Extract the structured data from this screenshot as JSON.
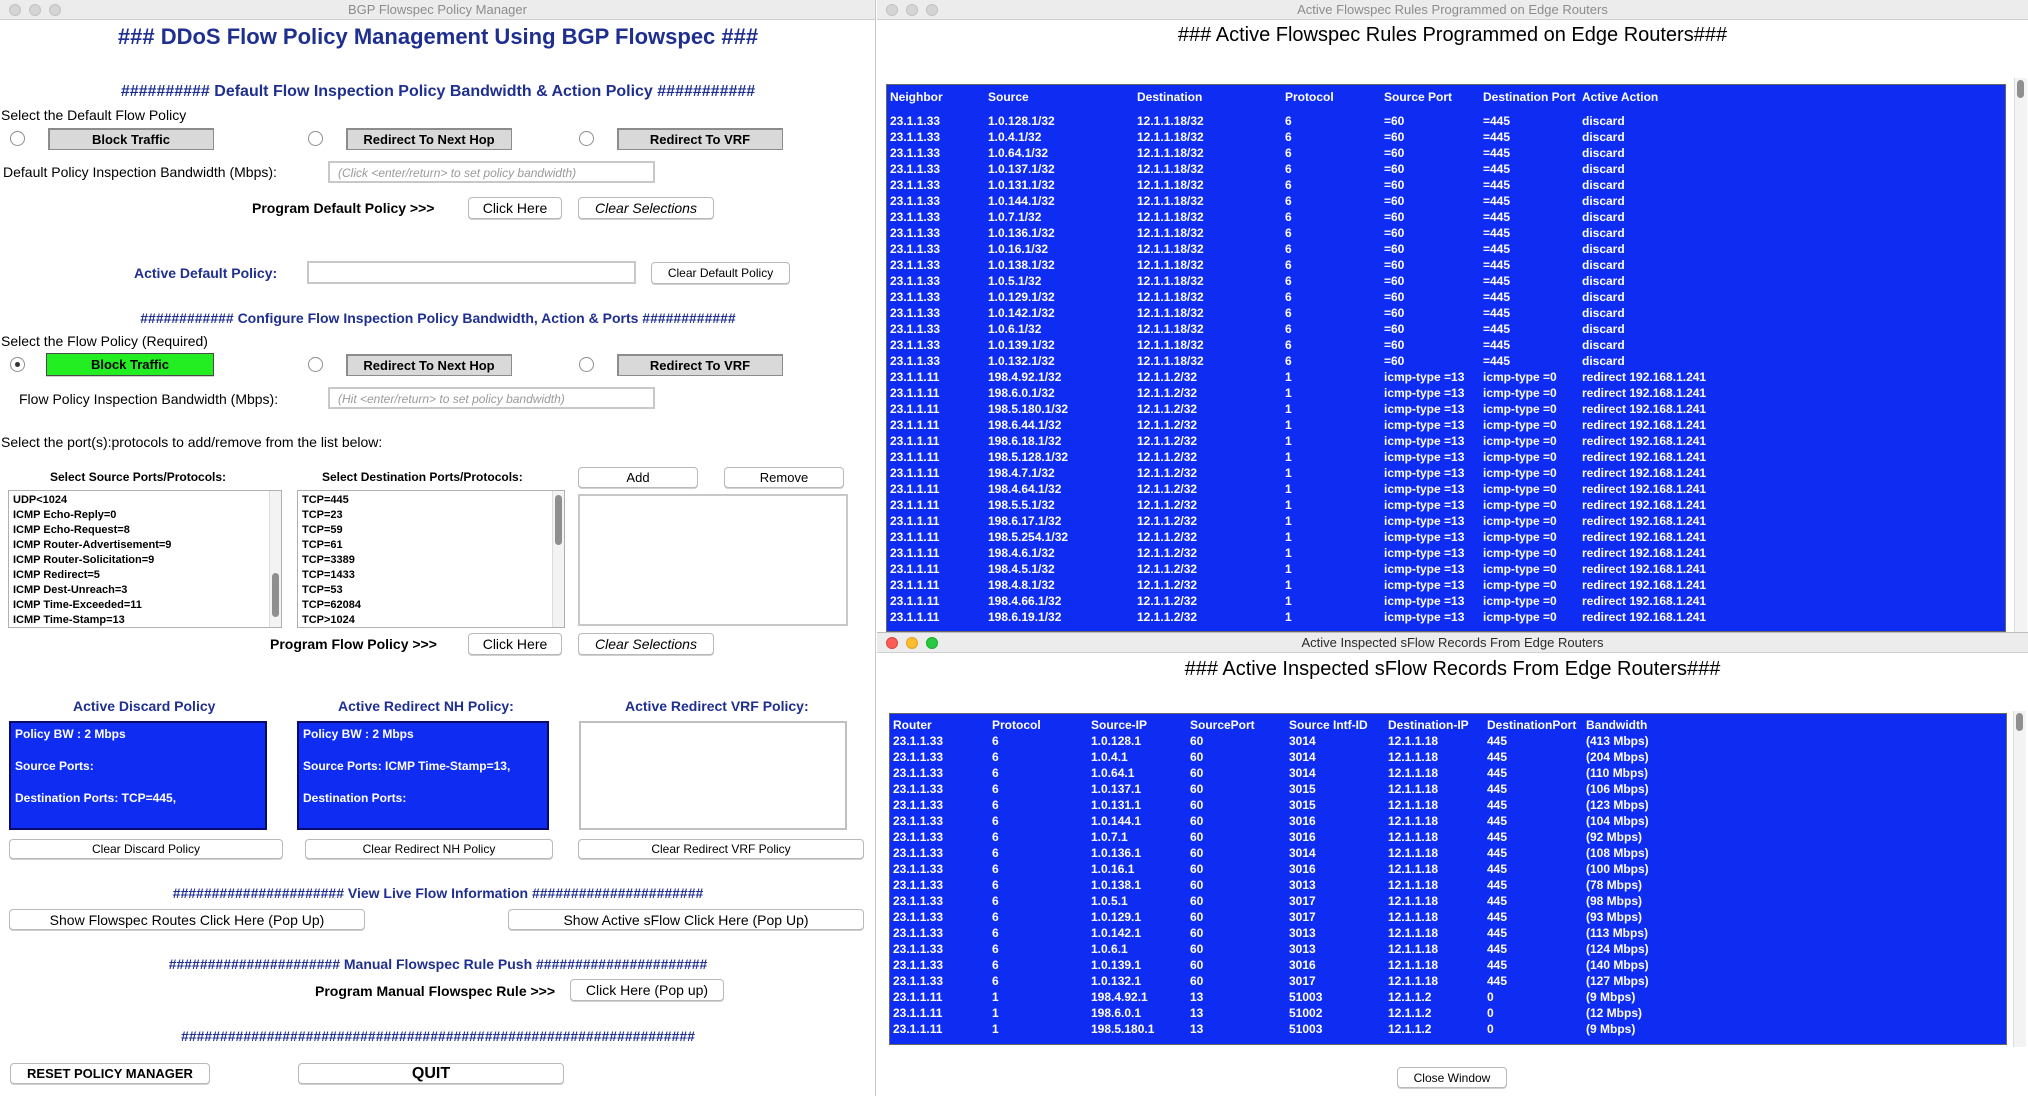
{
  "left": {
    "window_title": "BGP Flowspec Policy Manager",
    "heading": "### DDoS Flow Policy Management Using BGP Flowspec ###",
    "default_section": "########## Default Flow Inspection Policy Bandwidth & Action Policy ###########",
    "select_default_label": "Select the Default Flow Policy",
    "actions": [
      "Block Traffic",
      "Redirect To Next Hop",
      "Redirect To VRF"
    ],
    "default_bw_label": "Default Policy Inspection Bandwidth (Mbps):",
    "default_bw_placeholder": "(Click <enter/return> to set policy bandwidth)",
    "program_default_label": "Program Default Policy >>>",
    "click_here": "Click Here",
    "clear_selections": "Clear Selections",
    "active_default_label": "Active Default Policy:",
    "active_default_value": "",
    "clear_default": "Clear Default Policy",
    "flow_section": "############ Configure Flow Inspection Policy Bandwidth, Action & Ports ############",
    "select_flow_label": "Select the Flow Policy (Required)",
    "flow_bw_label": "Flow Policy Inspection Bandwidth (Mbps):",
    "flow_bw_placeholder": "(Hit <enter/return> to set policy bandwidth)",
    "ports_prompt": "Select the port(s):protocols to add/remove from the list below:",
    "src_ports_label": "Select Source Ports/Protocols:",
    "dst_ports_label": "Select Destination Ports/Protocols:",
    "add": "Add",
    "remove": "Remove",
    "src_ports": [
      "UDP<1024",
      "ICMP Echo-Reply=0",
      "ICMP Echo-Request=8",
      "ICMP Router-Advertisement=9",
      "ICMP Router-Solicitation=9",
      "ICMP Redirect=5",
      "ICMP Dest-Unreach=3",
      "ICMP Time-Exceeded=11",
      "ICMP Time-Stamp=13"
    ],
    "dst_ports": [
      "TCP=445",
      "TCP=23",
      "TCP=59",
      "TCP=61",
      "TCP=3389",
      "TCP=1433",
      "TCP=53",
      "TCP=62084",
      "TCP>1024"
    ],
    "program_flow_label": "Program Flow Policy >>>",
    "discard_title": "Active Discard Policy",
    "redirect_nh_title": "Active Redirect NH Policy:",
    "redirect_vrf_title": "Active Redirect VRF Policy:",
    "discard": {
      "bw": "Policy BW : 2 Mbps",
      "src": "Source Ports:",
      "dst": "Destination Ports:    TCP=445,"
    },
    "redirect_nh": {
      "bw": "Policy BW : 2 Mbps",
      "src": "Source Ports:    ICMP Time-Stamp=13,",
      "dst": "Destination Ports:"
    },
    "clear_discard": "Clear Discard Policy",
    "clear_redirect_nh": "Clear Redirect NH Policy",
    "clear_redirect_vrf": "Clear Redirect VRF Policy",
    "live_section": "###################### View Live Flow Information ######################",
    "show_flowspec": "Show Flowspec Routes Click Here (Pop Up)",
    "show_sflow": "Show Active sFlow Click Here (Pop Up)",
    "manual_section": "###################### Manual Flowspec Rule Push ######################",
    "manual_label": "Program Manual Flowspec Rule >>>",
    "manual_button": "Click Here (Pop up)",
    "footer_hash": "##################################################################",
    "reset": "RESET POLICY MANAGER",
    "quit": "QUIT"
  },
  "flowspec": {
    "window_title": "Active Flowspec Rules Programmed on Edge Routers",
    "heading": "### Active Flowspec Rules Programmed on Edge Routers###",
    "columns": [
      "Neighbor",
      "Source",
      "Destination",
      "Protocol",
      "Source Port",
      "Destination Port",
      "Active Action"
    ],
    "rows": [
      [
        "23.1.1.33",
        "1.0.128.1/32",
        "12.1.1.18/32",
        "6",
        "=60",
        "=445",
        "discard"
      ],
      [
        "23.1.1.33",
        "1.0.4.1/32",
        "12.1.1.18/32",
        "6",
        "=60",
        "=445",
        "discard"
      ],
      [
        "23.1.1.33",
        "1.0.64.1/32",
        "12.1.1.18/32",
        "6",
        "=60",
        "=445",
        "discard"
      ],
      [
        "23.1.1.33",
        "1.0.137.1/32",
        "12.1.1.18/32",
        "6",
        "=60",
        "=445",
        "discard"
      ],
      [
        "23.1.1.33",
        "1.0.131.1/32",
        "12.1.1.18/32",
        "6",
        "=60",
        "=445",
        "discard"
      ],
      [
        "23.1.1.33",
        "1.0.144.1/32",
        "12.1.1.18/32",
        "6",
        "=60",
        "=445",
        "discard"
      ],
      [
        "23.1.1.33",
        "1.0.7.1/32",
        "12.1.1.18/32",
        "6",
        "=60",
        "=445",
        "discard"
      ],
      [
        "23.1.1.33",
        "1.0.136.1/32",
        "12.1.1.18/32",
        "6",
        "=60",
        "=445",
        "discard"
      ],
      [
        "23.1.1.33",
        "1.0.16.1/32",
        "12.1.1.18/32",
        "6",
        "=60",
        "=445",
        "discard"
      ],
      [
        "23.1.1.33",
        "1.0.138.1/32",
        "12.1.1.18/32",
        "6",
        "=60",
        "=445",
        "discard"
      ],
      [
        "23.1.1.33",
        "1.0.5.1/32",
        "12.1.1.18/32",
        "6",
        "=60",
        "=445",
        "discard"
      ],
      [
        "23.1.1.33",
        "1.0.129.1/32",
        "12.1.1.18/32",
        "6",
        "=60",
        "=445",
        "discard"
      ],
      [
        "23.1.1.33",
        "1.0.142.1/32",
        "12.1.1.18/32",
        "6",
        "=60",
        "=445",
        "discard"
      ],
      [
        "23.1.1.33",
        "1.0.6.1/32",
        "12.1.1.18/32",
        "6",
        "=60",
        "=445",
        "discard"
      ],
      [
        "23.1.1.33",
        "1.0.139.1/32",
        "12.1.1.18/32",
        "6",
        "=60",
        "=445",
        "discard"
      ],
      [
        "23.1.1.33",
        "1.0.132.1/32",
        "12.1.1.18/32",
        "6",
        "=60",
        "=445",
        "discard"
      ],
      [
        "23.1.1.11",
        "198.4.92.1/32",
        "12.1.1.2/32",
        "1",
        "icmp-type =13",
        "icmp-type =0",
        "redirect 192.168.1.241"
      ],
      [
        "23.1.1.11",
        "198.6.0.1/32",
        "12.1.1.2/32",
        "1",
        "icmp-type =13",
        "icmp-type =0",
        "redirect 192.168.1.241"
      ],
      [
        "23.1.1.11",
        "198.5.180.1/32",
        "12.1.1.2/32",
        "1",
        "icmp-type =13",
        "icmp-type =0",
        "redirect 192.168.1.241"
      ],
      [
        "23.1.1.11",
        "198.6.44.1/32",
        "12.1.1.2/32",
        "1",
        "icmp-type =13",
        "icmp-type =0",
        "redirect 192.168.1.241"
      ],
      [
        "23.1.1.11",
        "198.6.18.1/32",
        "12.1.1.2/32",
        "1",
        "icmp-type =13",
        "icmp-type =0",
        "redirect 192.168.1.241"
      ],
      [
        "23.1.1.11",
        "198.5.128.1/32",
        "12.1.1.2/32",
        "1",
        "icmp-type =13",
        "icmp-type =0",
        "redirect 192.168.1.241"
      ],
      [
        "23.1.1.11",
        "198.4.7.1/32",
        "12.1.1.2/32",
        "1",
        "icmp-type =13",
        "icmp-type =0",
        "redirect 192.168.1.241"
      ],
      [
        "23.1.1.11",
        "198.4.64.1/32",
        "12.1.1.2/32",
        "1",
        "icmp-type =13",
        "icmp-type =0",
        "redirect 192.168.1.241"
      ],
      [
        "23.1.1.11",
        "198.5.5.1/32",
        "12.1.1.2/32",
        "1",
        "icmp-type =13",
        "icmp-type =0",
        "redirect 192.168.1.241"
      ],
      [
        "23.1.1.11",
        "198.6.17.1/32",
        "12.1.1.2/32",
        "1",
        "icmp-type =13",
        "icmp-type =0",
        "redirect 192.168.1.241"
      ],
      [
        "23.1.1.11",
        "198.5.254.1/32",
        "12.1.1.2/32",
        "1",
        "icmp-type =13",
        "icmp-type =0",
        "redirect 192.168.1.241"
      ],
      [
        "23.1.1.11",
        "198.4.6.1/32",
        "12.1.1.2/32",
        "1",
        "icmp-type =13",
        "icmp-type =0",
        "redirect 192.168.1.241"
      ],
      [
        "23.1.1.11",
        "198.4.5.1/32",
        "12.1.1.2/32",
        "1",
        "icmp-type =13",
        "icmp-type =0",
        "redirect 192.168.1.241"
      ],
      [
        "23.1.1.11",
        "198.4.8.1/32",
        "12.1.1.2/32",
        "1",
        "icmp-type =13",
        "icmp-type =0",
        "redirect 192.168.1.241"
      ],
      [
        "23.1.1.11",
        "198.4.66.1/32",
        "12.1.1.2/32",
        "1",
        "icmp-type =13",
        "icmp-type =0",
        "redirect 192.168.1.241"
      ],
      [
        "23.1.1.11",
        "198.6.19.1/32",
        "12.1.1.2/32",
        "1",
        "icmp-type =13",
        "icmp-type =0",
        "redirect 192.168.1.241"
      ]
    ]
  },
  "sflow": {
    "window_title": "Active Inspected sFlow Records From Edge Routers",
    "heading": "### Active Inspected sFlow Records From Edge Routers###",
    "columns": [
      "Router",
      "Protocol",
      "Source-IP",
      "SourcePort",
      "Source Intf-ID",
      "Destination-IP",
      "DestinationPort",
      "Bandwidth"
    ],
    "rows": [
      [
        "23.1.1.33",
        "6",
        "1.0.128.1",
        "60",
        "3014",
        "12.1.1.18",
        "445",
        "(413 Mbps)"
      ],
      [
        "23.1.1.33",
        "6",
        "1.0.4.1",
        "60",
        "3014",
        "12.1.1.18",
        "445",
        "(204 Mbps)"
      ],
      [
        "23.1.1.33",
        "6",
        "1.0.64.1",
        "60",
        "3014",
        "12.1.1.18",
        "445",
        "(110 Mbps)"
      ],
      [
        "23.1.1.33",
        "6",
        "1.0.137.1",
        "60",
        "3015",
        "12.1.1.18",
        "445",
        "(106 Mbps)"
      ],
      [
        "23.1.1.33",
        "6",
        "1.0.131.1",
        "60",
        "3015",
        "12.1.1.18",
        "445",
        "(123 Mbps)"
      ],
      [
        "23.1.1.33",
        "6",
        "1.0.144.1",
        "60",
        "3016",
        "12.1.1.18",
        "445",
        "(104 Mbps)"
      ],
      [
        "23.1.1.33",
        "6",
        "1.0.7.1",
        "60",
        "3016",
        "12.1.1.18",
        "445",
        "(92 Mbps)"
      ],
      [
        "23.1.1.33",
        "6",
        "1.0.136.1",
        "60",
        "3014",
        "12.1.1.18",
        "445",
        "(108 Mbps)"
      ],
      [
        "23.1.1.33",
        "6",
        "1.0.16.1",
        "60",
        "3016",
        "12.1.1.18",
        "445",
        "(100 Mbps)"
      ],
      [
        "23.1.1.33",
        "6",
        "1.0.138.1",
        "60",
        "3013",
        "12.1.1.18",
        "445",
        "(78 Mbps)"
      ],
      [
        "23.1.1.33",
        "6",
        "1.0.5.1",
        "60",
        "3017",
        "12.1.1.18",
        "445",
        "(98 Mbps)"
      ],
      [
        "23.1.1.33",
        "6",
        "1.0.129.1",
        "60",
        "3017",
        "12.1.1.18",
        "445",
        "(93 Mbps)"
      ],
      [
        "23.1.1.33",
        "6",
        "1.0.142.1",
        "60",
        "3013",
        "12.1.1.18",
        "445",
        "(113 Mbps)"
      ],
      [
        "23.1.1.33",
        "6",
        "1.0.6.1",
        "60",
        "3013",
        "12.1.1.18",
        "445",
        "(124 Mbps)"
      ],
      [
        "23.1.1.33",
        "6",
        "1.0.139.1",
        "60",
        "3016",
        "12.1.1.18",
        "445",
        "(140 Mbps)"
      ],
      [
        "23.1.1.33",
        "6",
        "1.0.132.1",
        "60",
        "3017",
        "12.1.1.18",
        "445",
        "(127 Mbps)"
      ],
      [
        "23.1.1.11",
        "1",
        "198.4.92.1",
        "13",
        "51003",
        "12.1.1.2",
        "0",
        "(9 Mbps)"
      ],
      [
        "23.1.1.11",
        "1",
        "198.6.0.1",
        "13",
        "51002",
        "12.1.1.2",
        "0",
        "(12 Mbps)"
      ],
      [
        "23.1.1.11",
        "1",
        "198.5.180.1",
        "13",
        "51003",
        "12.1.1.2",
        "0",
        "(9 Mbps)"
      ]
    ],
    "close": "Close Window"
  }
}
